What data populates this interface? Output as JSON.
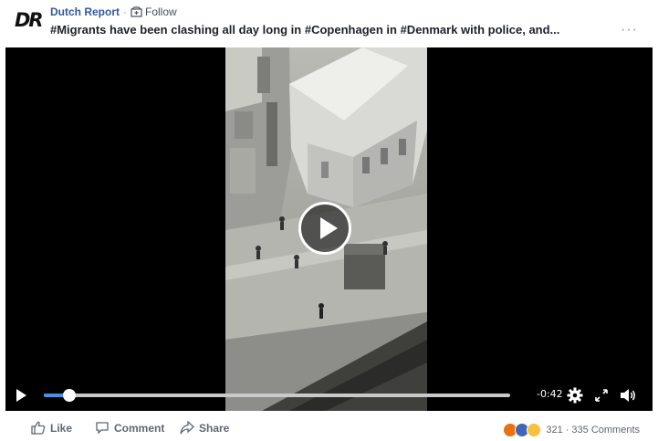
{
  "post": {
    "page_logo": "DR",
    "page_name": "Dutch Report",
    "separator": "·",
    "follow_label": "Follow",
    "title": "#Migrants have been clashing all day long in #Copenhagen in #Denmark with police, and...",
    "more_label": "···"
  },
  "video": {
    "time_remaining": "-0:42",
    "progress": 0.055
  },
  "actions": {
    "like_label": "Like",
    "comment_label": "Comment",
    "share_label": "Share"
  },
  "reactions": {
    "types": [
      "angry",
      "like",
      "wow"
    ],
    "count": "321",
    "separator": "·",
    "comments": "335 Comments"
  },
  "colors": {
    "link": "#365899",
    "progress": "#4a90e2",
    "text": "#1d2129",
    "muted": "#606770"
  }
}
